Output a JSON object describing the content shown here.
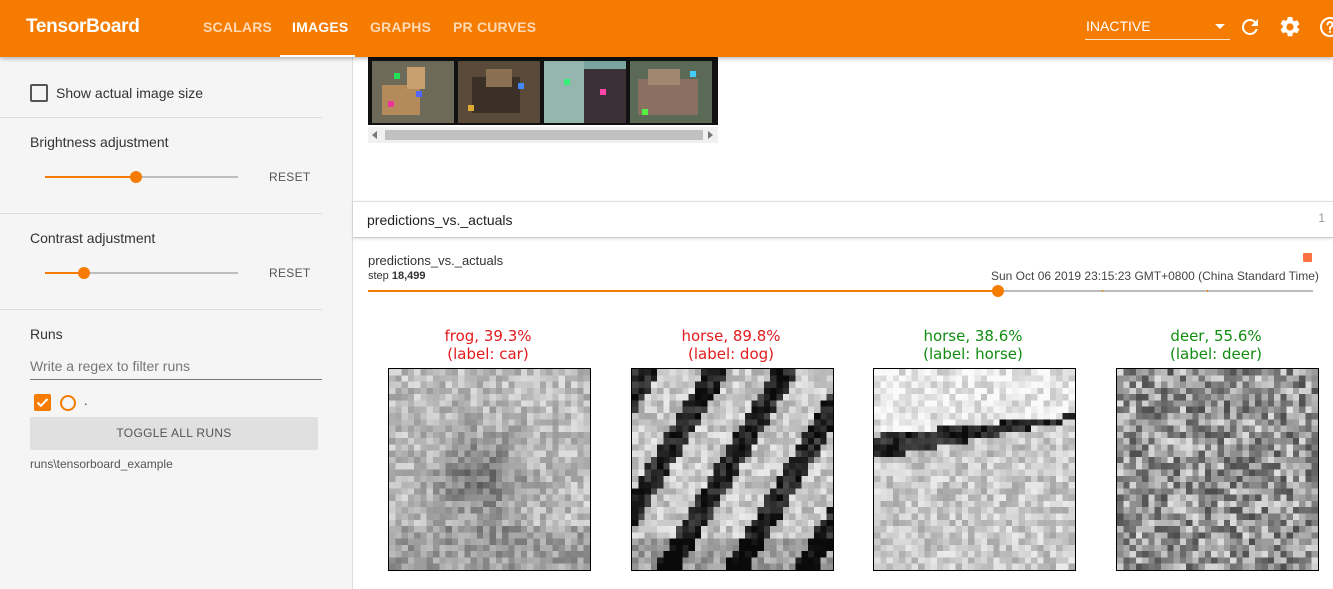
{
  "app": {
    "title": "TensorBoard"
  },
  "nav": {
    "tabs": [
      {
        "label": "SCALARS"
      },
      {
        "label": "IMAGES"
      },
      {
        "label": "GRAPHS"
      },
      {
        "label": "PR CURVES"
      }
    ],
    "active_tab": "IMAGES",
    "run_status": "INACTIVE",
    "icons": [
      "refresh-icon",
      "settings-icon",
      "help-icon"
    ]
  },
  "sidebar": {
    "show_actual_size": {
      "label": "Show actual image size",
      "checked": false
    },
    "brightness": {
      "label": "Brightness adjustment",
      "reset": "RESET",
      "value": 0.47
    },
    "contrast": {
      "label": "Contrast adjustment",
      "reset": "RESET",
      "value": 0.2
    },
    "runs": {
      "heading": "Runs",
      "filter_placeholder": "Write a regex to filter runs",
      "run_label": ".",
      "toggle_all": "TOGGLE ALL RUNS",
      "run_path": "runs\\tensorboard_example"
    }
  },
  "main": {
    "card": {
      "title": "predictions_vs._actuals",
      "count": "1"
    },
    "image": {
      "tag": "predictions_vs._actuals",
      "step_prefix": "step",
      "step_value": "18,499",
      "timestamp": "Sun Oct 06 2019 23:15:23 GMT+0800 (China Standard Time)",
      "step_position": 0.667
    },
    "colors": {
      "accent": "#f57c00",
      "wrong": "#e31a1c",
      "correct": "#118c11"
    },
    "predictions": [
      {
        "prediction": "frog, 39.3%",
        "label": "(label: car)",
        "correct": false
      },
      {
        "prediction": "horse, 89.8%",
        "label": "(label: dog)",
        "correct": false
      },
      {
        "prediction": "horse, 38.6%",
        "label": "(label: horse)",
        "correct": true
      },
      {
        "prediction": "deer, 55.6%",
        "label": "(label: deer)",
        "correct": true
      }
    ]
  }
}
